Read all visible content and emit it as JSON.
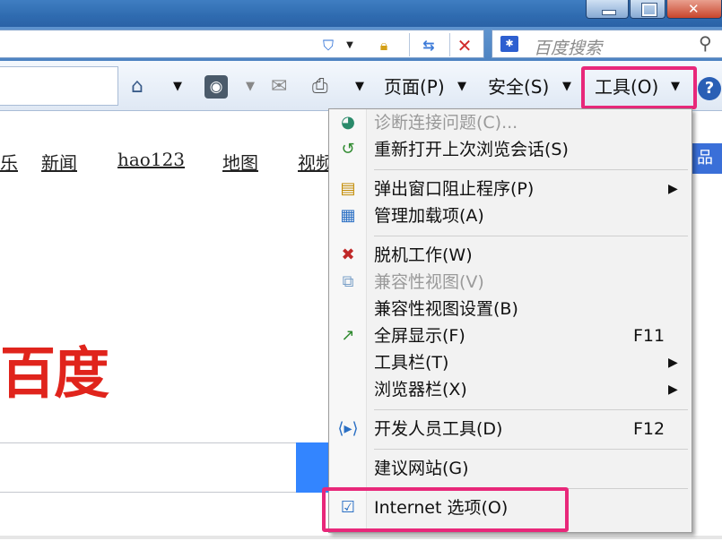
{
  "colors": {
    "accent_highlight": "#e8287a",
    "baidu_red": "#e0241c",
    "baidu_blue": "#3385ff",
    "frame_blue": "#3f7ec2"
  },
  "window": {
    "buttons": [
      "minimize",
      "maximize",
      "close"
    ]
  },
  "address_bar": {
    "icons": [
      "shield-icon",
      "lock-icon",
      "refresh-icon",
      "stop-icon"
    ],
    "search_placeholder": "百度搜索"
  },
  "command_bar": {
    "page_label": "页面(P)",
    "safety_label": "安全(S)",
    "tools_label": "工具(O)",
    "dropdown_glyph": "▼",
    "help_glyph": "?"
  },
  "page": {
    "nav_links": [
      "乐",
      "新闻",
      "hao123",
      "地图",
      "视频"
    ],
    "nav_more": "品",
    "logo_text": "百度"
  },
  "tools_menu": {
    "items": [
      {
        "label": "诊断连接问题(C)...",
        "icon": "diagnose-icon",
        "disabled": true
      },
      {
        "label": "重新打开上次浏览会话(S)",
        "icon": "reopen-session-icon"
      },
      {
        "label": "弹出窗口阻止程序(P)",
        "icon": "popup-blocker-icon",
        "submenu": true
      },
      {
        "label": "管理加载项(A)",
        "icon": "addons-icon"
      },
      {
        "label": "脱机工作(W)",
        "icon": "offline-icon"
      },
      {
        "label": "兼容性视图(V)",
        "icon": "compat-view-icon",
        "disabled": true
      },
      {
        "label": "兼容性视图设置(B)"
      },
      {
        "label": "全屏显示(F)",
        "icon": "fullscreen-icon",
        "shortcut": "F11"
      },
      {
        "label": "工具栏(T)",
        "submenu": true
      },
      {
        "label": "浏览器栏(X)",
        "submenu": true
      },
      {
        "label": "开发人员工具(D)",
        "icon": "dev-tools-icon",
        "shortcut": "F12"
      },
      {
        "label": "建议网站(G)"
      },
      {
        "label": "Internet 选项(O)",
        "icon": "internet-options-icon"
      }
    ],
    "submenu_arrow": "▶"
  }
}
